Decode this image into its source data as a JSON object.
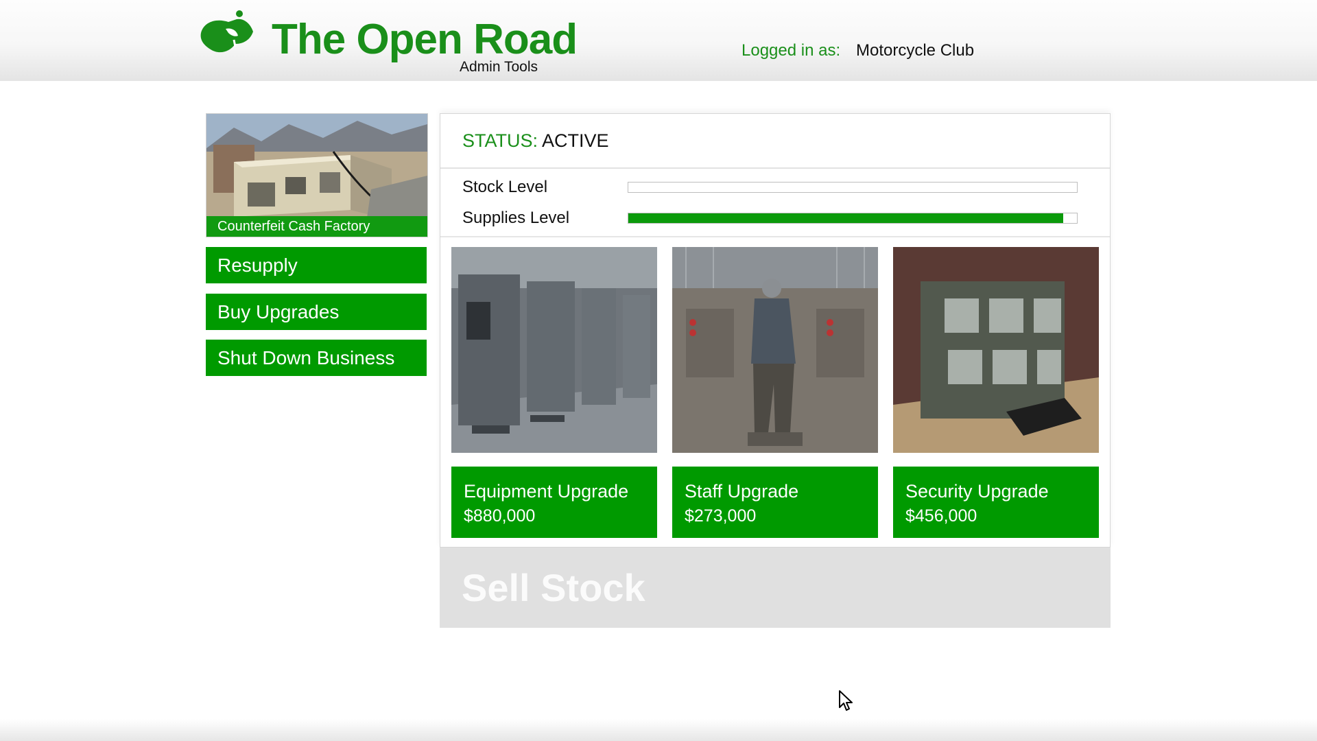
{
  "header": {
    "brand_title": "The Open Road",
    "brand_subtitle": "Admin Tools",
    "login_label": "Logged in as:",
    "login_user": "Motorcycle Club",
    "brand_color": "#1a8f1a",
    "logo_icon": "bike-leaf-logo"
  },
  "business": {
    "name": "Counterfeit Cash Factory",
    "image": "warehouse-exterior-photo"
  },
  "sidebar": {
    "buttons": [
      {
        "label": "Resupply"
      },
      {
        "label": "Buy Upgrades"
      },
      {
        "label": "Shut Down Business"
      }
    ]
  },
  "status": {
    "label": "STATUS:",
    "value": "ACTIVE",
    "levels": [
      {
        "label": "Stock Level",
        "fill_fraction": 0.0
      },
      {
        "label": "Supplies Level",
        "fill_fraction": 0.97
      }
    ]
  },
  "upgrades": [
    {
      "name": "Equipment Upgrade",
      "price": "$880,000",
      "image": "printing-machines-photo"
    },
    {
      "name": "Staff Upgrade",
      "price": "$273,000",
      "image": "worker-at-machine-photo"
    },
    {
      "name": "Security Upgrade",
      "price": "$456,000",
      "image": "cctv-monitors-photo"
    }
  ],
  "sell": {
    "label": "Sell Stock",
    "enabled": false
  },
  "accent_color": "#009a00",
  "cursor_icon": "mouse-pointer-icon"
}
